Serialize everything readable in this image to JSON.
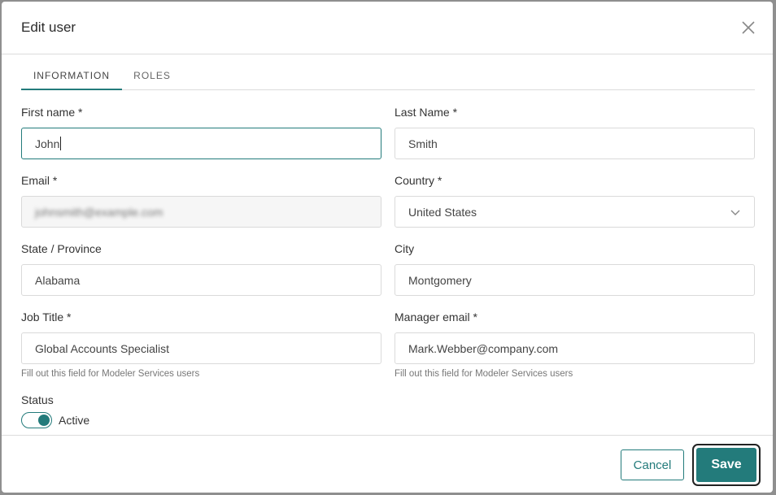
{
  "dialog": {
    "title": "Edit user",
    "close_icon": "close-icon"
  },
  "tabs": [
    {
      "label": "INFORMATION",
      "active": true
    },
    {
      "label": "ROLES",
      "active": false
    }
  ],
  "form": {
    "first_name": {
      "label": "First name *",
      "value": "John"
    },
    "last_name": {
      "label": "Last Name *",
      "value": "Smith"
    },
    "email": {
      "label": "Email *",
      "value": "johnsmith@example.com"
    },
    "country": {
      "label": "Country *",
      "value": "United States"
    },
    "state": {
      "label": "State / Province",
      "value": "Alabama"
    },
    "city": {
      "label": "City",
      "value": "Montgomery"
    },
    "job_title": {
      "label": "Job Title *",
      "value": "Global Accounts Specialist",
      "hint": "Fill out this field for Modeler Services users"
    },
    "manager_email": {
      "label": "Manager email *",
      "value": "Mark.Webber@company.com",
      "hint": "Fill out this field for Modeler Services users"
    },
    "status": {
      "label": "Status",
      "toggle_label": "Active",
      "on": true
    }
  },
  "footer": {
    "cancel_label": "Cancel",
    "save_label": "Save"
  },
  "colors": {
    "accent": "#237b7b"
  }
}
